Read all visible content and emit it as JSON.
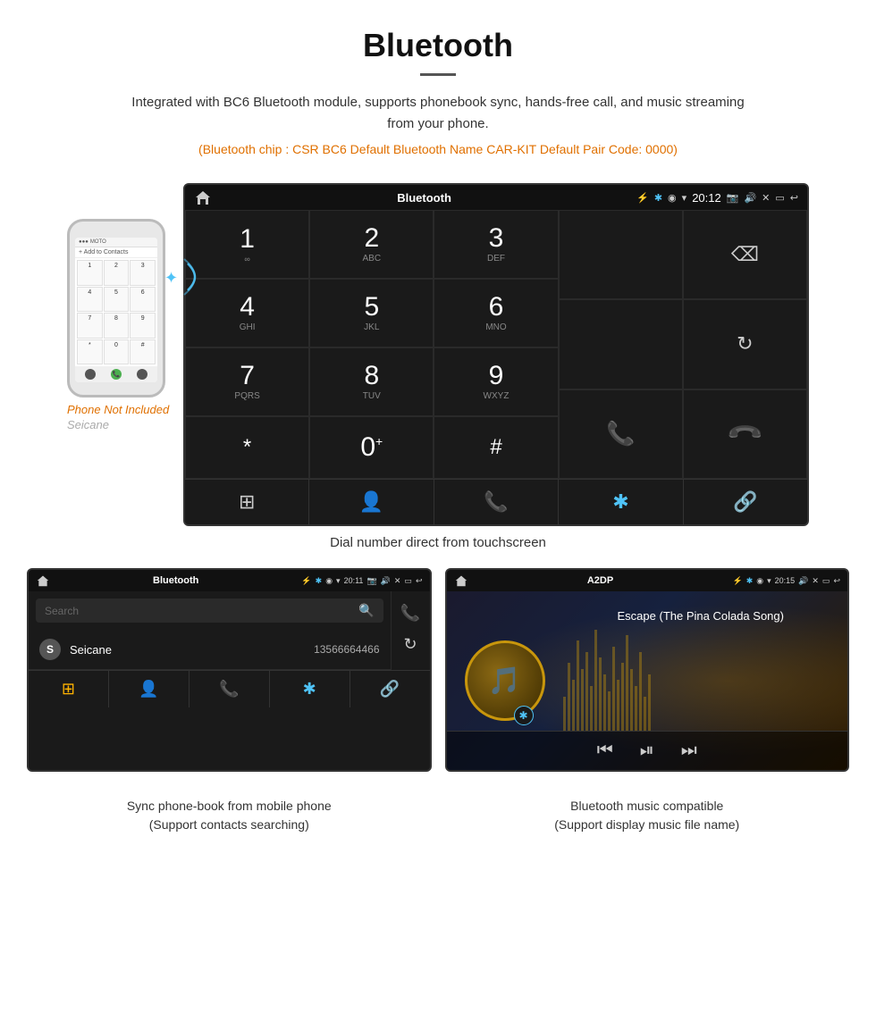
{
  "header": {
    "title": "Bluetooth",
    "description": "Integrated with BC6 Bluetooth module, supports phonebook sync, hands-free call, and music streaming from your phone.",
    "specs": "(Bluetooth chip : CSR BC6   Default Bluetooth Name CAR-KIT   Default Pair Code: 0000)"
  },
  "carScreen": {
    "statusBar": {
      "appName": "Bluetooth",
      "time": "20:12",
      "usbIcon": "⚡"
    },
    "dialKeys": [
      {
        "num": "1",
        "letters": "∞"
      },
      {
        "num": "2",
        "letters": "ABC"
      },
      {
        "num": "3",
        "letters": "DEF"
      },
      {
        "num": "4",
        "letters": "GHI"
      },
      {
        "num": "5",
        "letters": "JKL"
      },
      {
        "num": "6",
        "letters": "MNO"
      },
      {
        "num": "7",
        "letters": "PQRS"
      },
      {
        "num": "8",
        "letters": "TUV"
      },
      {
        "num": "9",
        "letters": "WXYZ"
      },
      {
        "num": "*",
        "letters": ""
      },
      {
        "num": "0",
        "letters": "+"
      },
      {
        "num": "#",
        "letters": ""
      }
    ],
    "bottomNav": [
      "⊞",
      "👤",
      "📞",
      "✱",
      "🔗"
    ]
  },
  "mainCaption": "Dial number direct from touchscreen",
  "phonebookPanel": {
    "statusBar": {
      "appName": "Bluetooth",
      "time": "20:11"
    },
    "searchPlaceholder": "Search",
    "contacts": [
      {
        "initial": "S",
        "name": "Seicane",
        "phone": "13566664466"
      }
    ],
    "bottomNav": [
      "⊞",
      "👤",
      "📞",
      "✱",
      "🔗"
    ]
  },
  "musicPanel": {
    "statusBar": {
      "appName": "A2DP",
      "time": "20:15"
    },
    "songTitle": "Escape (The Pina Colada Song)",
    "controls": [
      "⏮",
      "⏯",
      "⏭"
    ]
  },
  "phoneNotIncluded": "Phone Not Included",
  "seicaneWatermark": "Seicane",
  "panelCaptions": {
    "phonebook": "Sync phone-book from mobile phone\n(Support contacts searching)",
    "music": "Bluetooth music compatible\n(Support display music file name)"
  }
}
